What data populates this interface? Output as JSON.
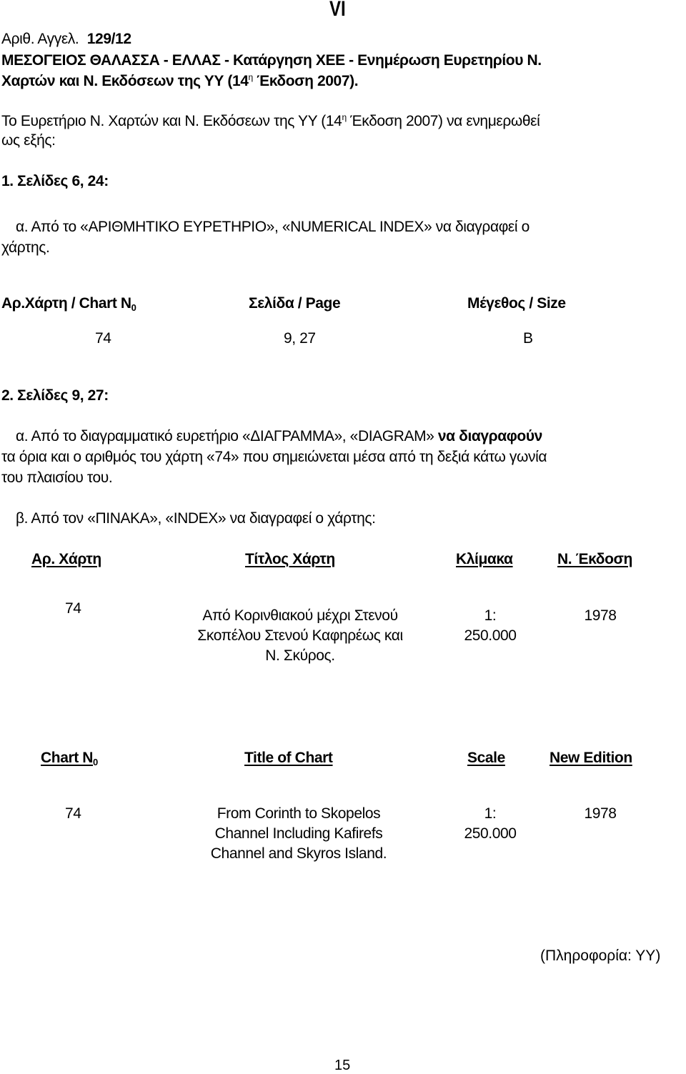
{
  "page_section": "VI",
  "notice": {
    "number_label": "Αριθ. Αγγελ.",
    "number_value": "129/12",
    "title_line1": "ΜΕΣΟΓΕΙΟΣ ΘΑΛΑΣΣΑ - ΕΛΛΑΣ - Κατάργηση ΧΕΕ - Ενημέρωση Ευρετηρίου Ν.",
    "title_line2_pre": "Χαρτών και Ν. Εκδόσεων της ΥΥ (14",
    "title_line2_sup": "η",
    "title_line2_post": " Έκδοση 2007)."
  },
  "intro": {
    "line1_pre": "Το Ευρετήριο Ν. Χαρτών και Ν. Εκδόσεων της ΥΥ (14",
    "line1_sup": "η",
    "line1_post": " Έκδοση 2007) να ενημερωθεί",
    "line2": "ως εξής:"
  },
  "section1": {
    "heading": "1. Σελίδες  6, 24:",
    "item_a_line1": "α. Από το «ΑΡΙΘΜΗΤΙΚΟ ΕΥΡΕΤΗΡΙΟ», «NUMERICAL INDEX» να διαγραφεί ο",
    "item_a_line2": "χάρτης.",
    "table": {
      "headers": [
        "Αρ.Χάρτη / Chart N",
        "Σελίδα / Page",
        "Μέγεθος / Size"
      ],
      "header_sub": "0",
      "row": [
        "74",
        "9, 27",
        "B"
      ]
    }
  },
  "section2": {
    "heading": "2. Σελίδες  9, 27:",
    "item_a_line1_normal": "α. Από το διαγραμματικό ευρετήριο «ΔΙΑΓΡΑΜΜΑ», «DIAGRAM» ",
    "item_a_line1_bold": "να διαγραφούν",
    "item_a_line2": "τα όρια και ο αριθμός του χάρτη «74» που σημειώνεται μέσα από τη δεξιά κάτω γωνία",
    "item_a_line3": "του πλαισίου του.",
    "item_b": "β. Από τον «ΠΙΝΑΚΑ», «INDEX» να διαγραφεί ο χάρτης:",
    "greek_table": {
      "headers": [
        "Αρ. Χάρτη",
        "Τίτλος Χάρτη",
        "Κλίμακα",
        "Ν. Έκδοση"
      ],
      "row": {
        "chart_no": "74",
        "title_lines": [
          "Από Κορινθιακού μέχρι Στενού",
          "Σκοπέλου  Στενού Καφηρέως και",
          "Ν. Σκύρος."
        ],
        "scale_lines": [
          "1:",
          "250.000"
        ],
        "edition": "1978"
      }
    },
    "english_table": {
      "headers": [
        "Chart N",
        "Title of Chart",
        "Scale",
        "New Edition"
      ],
      "header_sub": "0",
      "row": {
        "chart_no": "74",
        "title_lines": [
          "From Corinth to Skopelos",
          "Channel Including Kafirefs",
          "Channel and Skyros Island."
        ],
        "scale_lines": [
          "1:",
          "250.000"
        ],
        "edition": "1978"
      }
    }
  },
  "source_note": "(Πληροφορία: ΥΥ)",
  "page_number": "15"
}
